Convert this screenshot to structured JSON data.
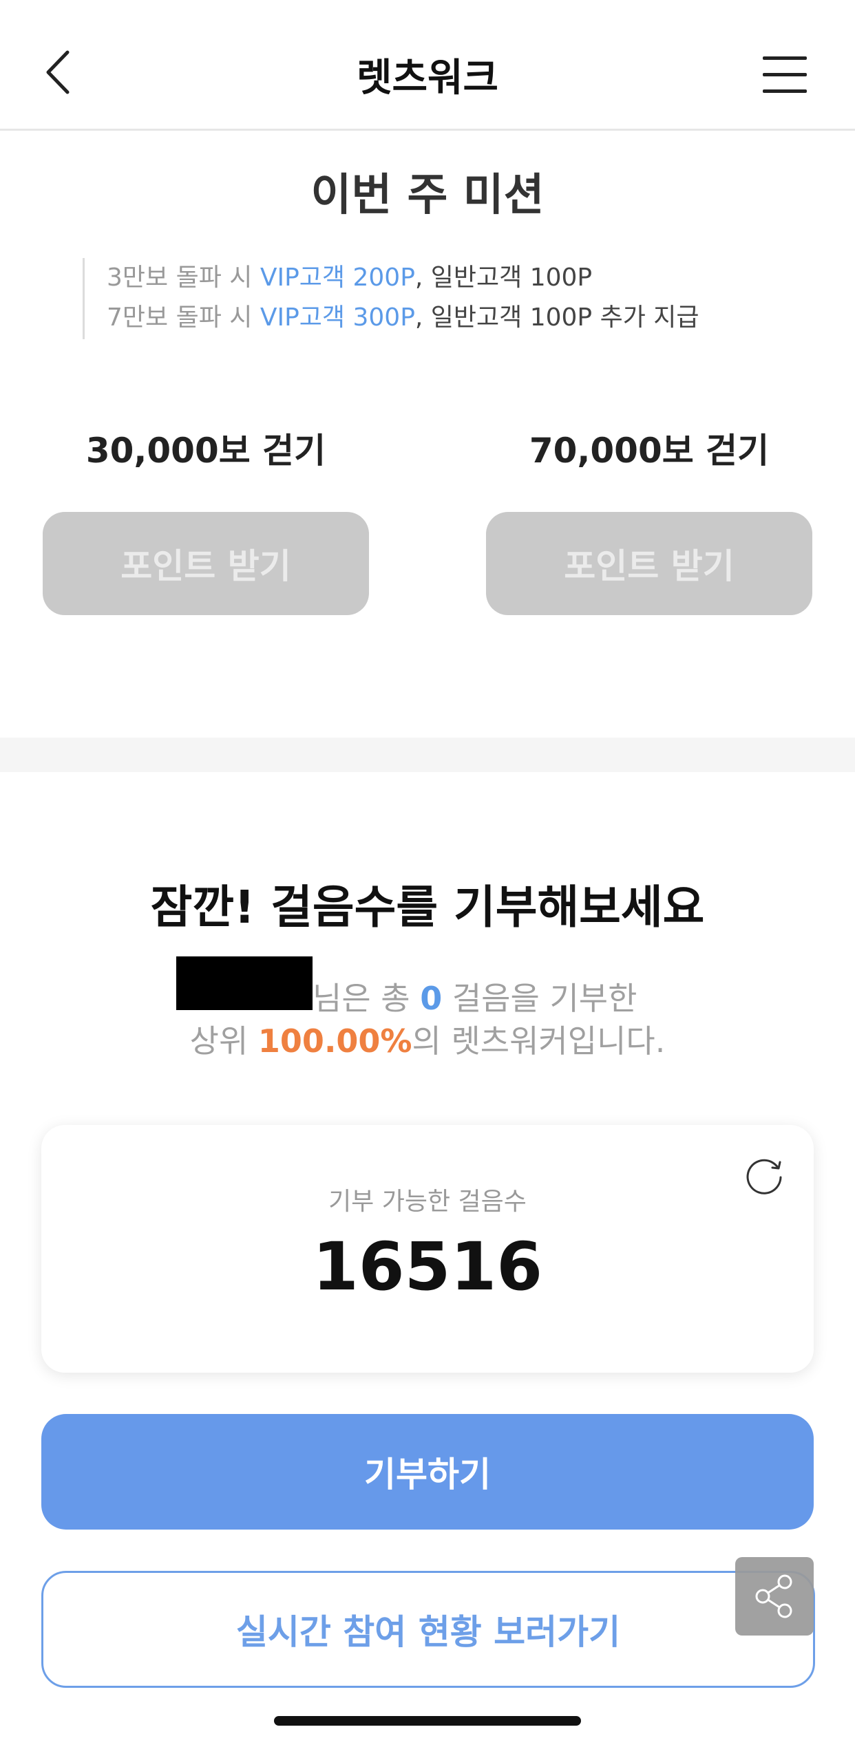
{
  "header": {
    "title": "렛츠워크",
    "back_icon": "chevron-left-icon",
    "menu_icon": "hamburger-menu-icon"
  },
  "mission": {
    "title": "이번 주 미션",
    "desc_line1": {
      "prefix": "3만보 돌파 시 ",
      "vip": "VIP고객 200P",
      "rest": ", 일반고객 100P"
    },
    "desc_line2": {
      "prefix": "7만보 돌파 시 ",
      "vip": "VIP고객 300P",
      "rest": ", 일반고객 100P 추가 지급"
    },
    "goals": [
      {
        "label": "30,000보 걷기",
        "button": "포인트 받기"
      },
      {
        "label": "70,000보 걷기",
        "button": "포인트 받기"
      }
    ]
  },
  "donation": {
    "title": "잠깐! 걸음수를 기부해보세요",
    "line1_suffix": "님은 총 ",
    "donated_steps": "0",
    "line1_end": " 걸음을 기부한",
    "line2_prefix": "상위 ",
    "rank_percent": "100.00%",
    "line2_end": "의 렛츠워커입니다.",
    "card": {
      "label": "기부 가능한 걸음수",
      "value": "16516",
      "refresh_icon": "refresh-icon"
    },
    "donate_button": "기부하기",
    "status_button": "실시간 참여 현황 보러가기",
    "share_icon": "share-icon"
  },
  "colors": {
    "accent_blue": "#6699ea",
    "highlight_orange": "#ef8040",
    "disabled_gray": "#c9c9c9"
  }
}
